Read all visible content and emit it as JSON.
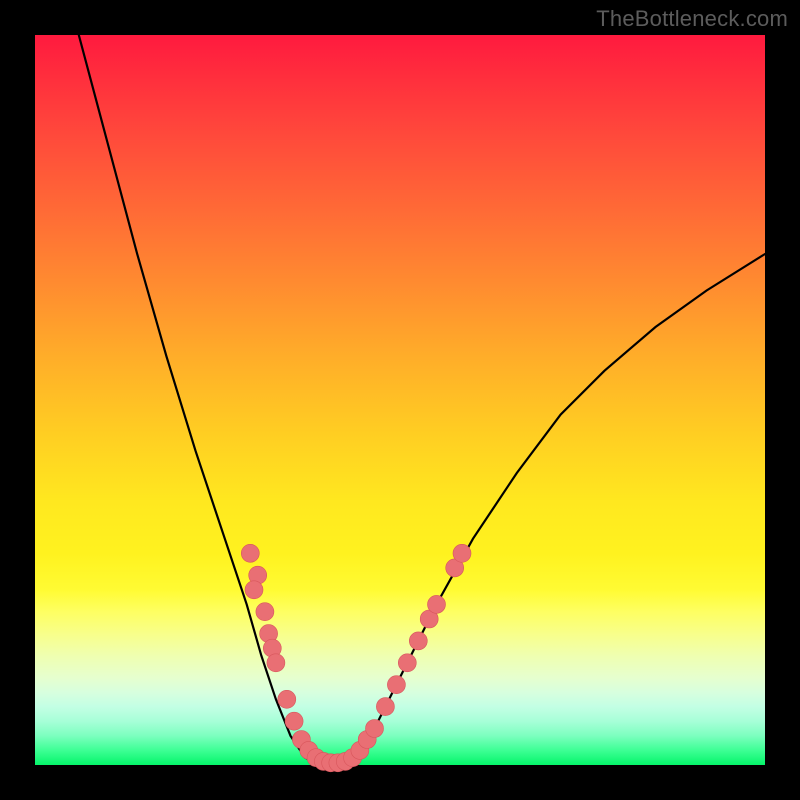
{
  "watermark": "TheBottleneck.com",
  "colors": {
    "dot": "#e96f74",
    "dot_stroke": "#d8565c",
    "curve": "#000000",
    "frame": "#000000"
  },
  "chart_data": {
    "type": "line",
    "title": "",
    "xlabel": "",
    "ylabel": "",
    "xlim": [
      0,
      100
    ],
    "ylim": [
      0,
      100
    ],
    "curve": [
      {
        "x": 6,
        "y": 100
      },
      {
        "x": 10,
        "y": 85
      },
      {
        "x": 14,
        "y": 70
      },
      {
        "x": 18,
        "y": 56
      },
      {
        "x": 22,
        "y": 43
      },
      {
        "x": 26,
        "y": 31
      },
      {
        "x": 29,
        "y": 22
      },
      {
        "x": 31,
        "y": 15
      },
      {
        "x": 33,
        "y": 9
      },
      {
        "x": 35,
        "y": 4
      },
      {
        "x": 37,
        "y": 1
      },
      {
        "x": 39,
        "y": 0
      },
      {
        "x": 41,
        "y": 0
      },
      {
        "x": 43,
        "y": 0.5
      },
      {
        "x": 46,
        "y": 4
      },
      {
        "x": 50,
        "y": 12
      },
      {
        "x": 55,
        "y": 22
      },
      {
        "x": 60,
        "y": 31
      },
      {
        "x": 66,
        "y": 40
      },
      {
        "x": 72,
        "y": 48
      },
      {
        "x": 78,
        "y": 54
      },
      {
        "x": 85,
        "y": 60
      },
      {
        "x": 92,
        "y": 65
      },
      {
        "x": 100,
        "y": 70
      }
    ],
    "points": [
      {
        "x": 29.5,
        "y": 29
      },
      {
        "x": 30.5,
        "y": 26
      },
      {
        "x": 30.0,
        "y": 24
      },
      {
        "x": 31.5,
        "y": 21
      },
      {
        "x": 32.0,
        "y": 18
      },
      {
        "x": 32.5,
        "y": 16
      },
      {
        "x": 33.0,
        "y": 14
      },
      {
        "x": 34.5,
        "y": 9
      },
      {
        "x": 35.5,
        "y": 6
      },
      {
        "x": 36.5,
        "y": 3.5
      },
      {
        "x": 37.5,
        "y": 2
      },
      {
        "x": 38.5,
        "y": 1
      },
      {
        "x": 39.5,
        "y": 0.5
      },
      {
        "x": 40.5,
        "y": 0.3
      },
      {
        "x": 41.5,
        "y": 0.3
      },
      {
        "x": 42.5,
        "y": 0.5
      },
      {
        "x": 43.5,
        "y": 1
      },
      {
        "x": 44.5,
        "y": 2
      },
      {
        "x": 45.5,
        "y": 3.5
      },
      {
        "x": 46.5,
        "y": 5
      },
      {
        "x": 48.0,
        "y": 8
      },
      {
        "x": 49.5,
        "y": 11
      },
      {
        "x": 51.0,
        "y": 14
      },
      {
        "x": 52.5,
        "y": 17
      },
      {
        "x": 54.0,
        "y": 20
      },
      {
        "x": 55.0,
        "y": 22
      },
      {
        "x": 57.5,
        "y": 27
      },
      {
        "x": 58.5,
        "y": 29
      }
    ]
  }
}
